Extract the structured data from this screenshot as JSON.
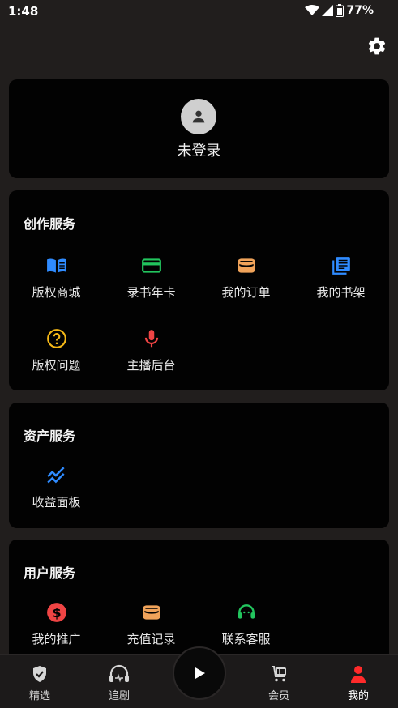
{
  "status": {
    "time": "1:48",
    "battery": "77%",
    "icons": [
      "wifi-icon",
      "cellular-icon",
      "battery-icon"
    ]
  },
  "header": {
    "settings_icon": "gear-icon"
  },
  "login": {
    "label": "未登录",
    "avatar_icon": "person-icon"
  },
  "creation": {
    "title": "创作服务",
    "items": [
      {
        "label": "版权商城",
        "icon": "open-book-icon",
        "color": "#2f8bff"
      },
      {
        "label": "录书年卡",
        "icon": "card-icon",
        "color": "#22c55e"
      },
      {
        "label": "我的订单",
        "icon": "wallet-icon",
        "color": "#f0a35a"
      },
      {
        "label": "我的书架",
        "icon": "library-icon",
        "color": "#2f8bff"
      },
      {
        "label": "版权问题",
        "icon": "help-circle-icon",
        "color": "#f5b817"
      },
      {
        "label": "主播后台",
        "icon": "microphone-icon",
        "color": "#ef4444"
      }
    ]
  },
  "assets": {
    "title": "资产服务",
    "items": [
      {
        "label": "收益面板",
        "icon": "trend-chart-icon",
        "color": "#2f8bff"
      }
    ]
  },
  "user_services": {
    "title": "用户服务",
    "items": [
      {
        "label": "我的推广",
        "icon": "dollar-circle-icon",
        "color": "#ef4444"
      },
      {
        "label": "充值记录",
        "icon": "wallet-icon",
        "color": "#f0a35a"
      },
      {
        "label": "联系客服",
        "icon": "headset-icon",
        "color": "#22c55e"
      }
    ]
  },
  "nav": {
    "items": [
      {
        "label": "精选",
        "icon": "shield-check-icon"
      },
      {
        "label": "追剧",
        "icon": "headphones-icon"
      },
      {
        "label": "会员",
        "icon": "cart-icon"
      },
      {
        "label": "我的",
        "icon": "person-icon",
        "active": true,
        "color": "#ff2a2a"
      }
    ],
    "play_icon": "play-icon"
  }
}
